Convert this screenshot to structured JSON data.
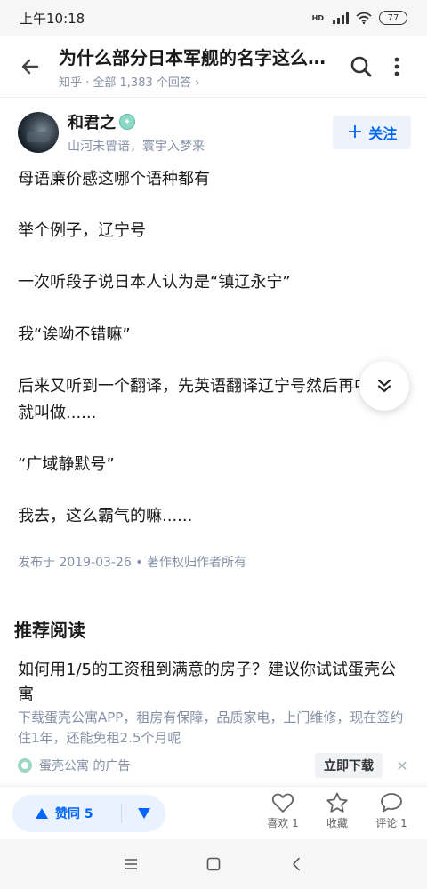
{
  "status_bar": {
    "time": "上午10:18",
    "network": "HD",
    "battery": "77"
  },
  "header": {
    "title": "为什么部分日本军舰的名字这么优雅？",
    "subtitle": "知乎 · 全部 1,383 个回答 ›"
  },
  "author": {
    "name": "和君之",
    "bio": "山河未曾谙，寰宇入梦来",
    "follow_label": "关注"
  },
  "answer": {
    "paragraphs": [
      "母语廉价感这哪个语种都有",
      "举个例子，辽宁号",
      "一次听段子说日本人认为是“镇辽永宁”",
      "我“诶呦不错嘛”",
      "后来又听到一个翻译，先英语翻译辽宁号然后再中文，就叫做......",
      "“广域静默号”",
      "我去，这么霸气的嘛......"
    ],
    "meta": "发布于 2019-03-26 • 著作权归作者所有"
  },
  "recommended": {
    "heading": "推荐阅读",
    "ad_title": "如何用1/5的工资租到满意的房子？建议你试试蛋壳公寓",
    "ad_desc": "下载蛋壳公寓APP，租房有保障，品质家电，上门维修，现在签约住1年，还能免租2.5个月呢",
    "ad_source": "蛋壳公寓 的广告",
    "ad_button": "立即下载"
  },
  "actions": {
    "upvote_label": "赞同 5",
    "like_label": "喜欢 1",
    "favorite_label": "收藏",
    "comment_label": "评论 1"
  },
  "colors": {
    "brand": "#0066ff",
    "secondary_text": "#8590a6"
  }
}
